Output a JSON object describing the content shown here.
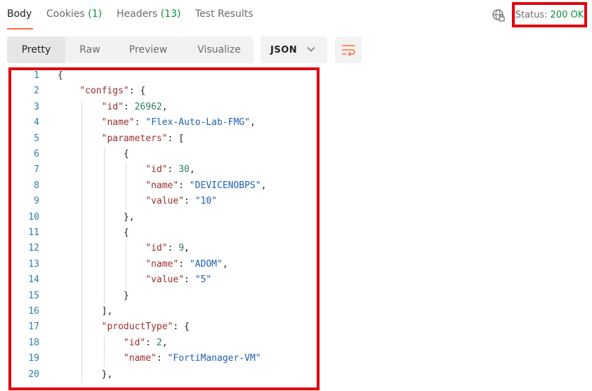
{
  "tabs": {
    "body": "Body",
    "cookies": "Cookies",
    "cookies_count": "(1)",
    "headers": "Headers",
    "headers_count": "(13)",
    "test_results": "Test Results"
  },
  "status": {
    "label": "Status:",
    "value": "200 OK"
  },
  "view_modes": {
    "pretty": "Pretty",
    "raw": "Raw",
    "preview": "Preview",
    "visualize": "Visualize"
  },
  "format": {
    "selected": "JSON"
  },
  "code_lines": [
    {
      "num": "1",
      "text": "{"
    },
    {
      "num": "2",
      "text": "    \"configs\": {"
    },
    {
      "num": "3",
      "text": "        \"id\": 26962,"
    },
    {
      "num": "4",
      "text": "        \"name\": \"Flex-Auto-Lab-FMG\","
    },
    {
      "num": "5",
      "text": "        \"parameters\": ["
    },
    {
      "num": "6",
      "text": "            {"
    },
    {
      "num": "7",
      "text": "                \"id\": 30,"
    },
    {
      "num": "8",
      "text": "                \"name\": \"DEVICENOBPS\","
    },
    {
      "num": "9",
      "text": "                \"value\": \"10\""
    },
    {
      "num": "10",
      "text": "            },"
    },
    {
      "num": "11",
      "text": "            {"
    },
    {
      "num": "12",
      "text": "                \"id\": 9,"
    },
    {
      "num": "13",
      "text": "                \"name\": \"ADOM\","
    },
    {
      "num": "14",
      "text": "                \"value\": \"5\""
    },
    {
      "num": "15",
      "text": "            }"
    },
    {
      "num": "16",
      "text": "        ],"
    },
    {
      "num": "17",
      "text": "        \"productType\": {"
    },
    {
      "num": "18",
      "text": "            \"id\": 2,"
    },
    {
      "num": "19",
      "text": "            \"name\": \"FortiManager-VM\""
    },
    {
      "num": "20",
      "text": "        },"
    }
  ]
}
